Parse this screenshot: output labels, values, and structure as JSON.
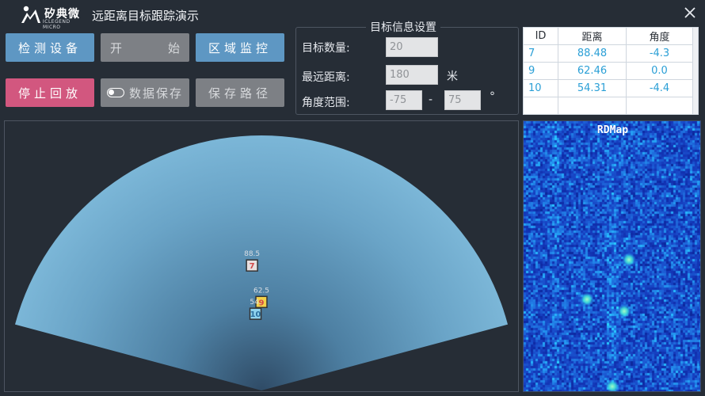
{
  "header": {
    "logo_text": "矽典微",
    "logo_subtext": "ICLEGEND MICRO",
    "title": "远距离目标跟踪演示"
  },
  "buttons": {
    "detect": "检测设备",
    "start_left": "开",
    "start_right": "始",
    "zone": "区域监控",
    "stop": "停止回放",
    "save_data": "数据保存",
    "save_path": "保存路径"
  },
  "settings": {
    "title": "目标信息设置",
    "count_label": "目标数量:",
    "count_value": "20",
    "range_label": "最远距离:",
    "range_value": "180",
    "range_unit": "米",
    "angle_label": "角度范围:",
    "angle_min": "-75",
    "angle_sep": "-",
    "angle_max": "75",
    "angle_unit": "°"
  },
  "table": {
    "headers": [
      "ID",
      "距离",
      "角度"
    ],
    "rows": [
      [
        "7",
        "88.48",
        "-4.3"
      ],
      [
        "9",
        "62.46",
        "0.0"
      ],
      [
        "10",
        "54.31",
        "-4.4"
      ]
    ]
  },
  "radar": {
    "max_range": 180,
    "angle_min": -75,
    "angle_max": 75,
    "targets": [
      {
        "id": "7",
        "distance": 88.48,
        "angle": -4.3,
        "label": "88.5",
        "fill": "#e8e0e0",
        "text": "#d24848"
      },
      {
        "id": "9",
        "distance": 62.46,
        "angle": 0.0,
        "label": "62.5",
        "fill": "#f2d14a",
        "text": "#d24848"
      },
      {
        "id": "10",
        "distance": 54.31,
        "angle": -4.4,
        "label": "54.",
        "fill": "#8fd3ee",
        "text": "#2b6f9e"
      }
    ]
  },
  "rdmap": {
    "title": "RDMap"
  },
  "colors": {
    "accent_blue": "#5e97c3",
    "disabled_gray": "#7d8085",
    "stop_pink": "#d2577f",
    "table_text": "#2a9fd6",
    "background": "#262d36"
  },
  "icons": {
    "logo": "iclegend-logo-icon",
    "close": "close-icon",
    "toggle": "toggle-switch-icon"
  }
}
